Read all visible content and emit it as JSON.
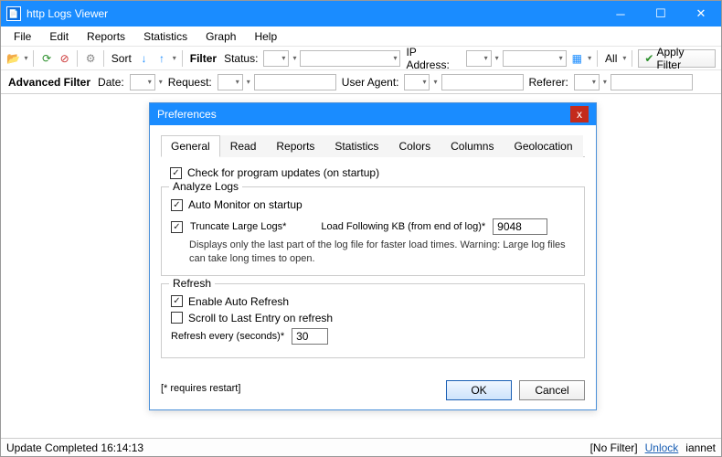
{
  "window": {
    "title": "http Logs Viewer"
  },
  "menu": {
    "file": "File",
    "edit": "Edit",
    "reports": "Reports",
    "statistics": "Statistics",
    "graph": "Graph",
    "help": "Help"
  },
  "toolbar": {
    "sort": "Sort",
    "filter": "Filter",
    "status": "Status:",
    "ip_address": "IP Address:",
    "all": "All",
    "apply_filter": "Apply Filter"
  },
  "toolbar2": {
    "advanced_filter": "Advanced Filter",
    "date": "Date:",
    "request": "Request:",
    "user_agent": "User Agent:",
    "referer": "Referer:"
  },
  "dialog": {
    "title": "Preferences",
    "tabs": {
      "general": "General",
      "read": "Read",
      "reports": "Reports",
      "statistics": "Statistics",
      "colors": "Colors",
      "columns": "Columns",
      "geolocation": "Geolocation"
    },
    "check_updates": "Check for program updates (on startup)",
    "analyze_logs": {
      "legend": "Analyze Logs",
      "auto_monitor": "Auto Monitor on startup",
      "truncate": "Truncate Large Logs*",
      "load_following": "Load Following KB (from end of log)*",
      "kb_value": "9048",
      "note": "Displays only the last part of the log file for faster load times. Warning: Large log files can take long times to open."
    },
    "refresh": {
      "legend": "Refresh",
      "enable": "Enable Auto Refresh",
      "scroll": "Scroll to Last Entry on refresh",
      "every_label": "Refresh every (seconds)*",
      "every_value": "30"
    },
    "requires_restart": "[* requires restart]",
    "ok": "OK",
    "cancel": "Cancel"
  },
  "status": {
    "left": "Update Completed 16:14:13",
    "no_filter": "[No Filter]",
    "unlock": "Unlock",
    "user": "iannet"
  }
}
